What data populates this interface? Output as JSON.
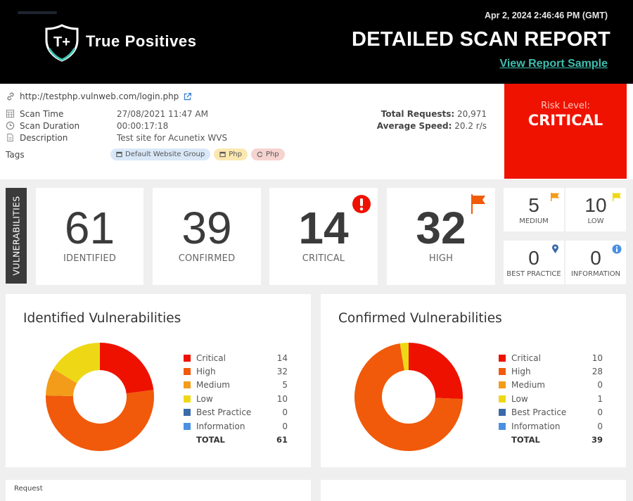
{
  "header": {
    "brand": "True Positives",
    "datetime": "Apr 2, 2024  2:46:46 PM (GMT)",
    "title": "DETAILED SCAN REPORT",
    "link": "View Report Sample"
  },
  "info": {
    "url": "http://testphp.vulnweb.com/login.php",
    "rows": [
      {
        "icon": "calendar-icon",
        "label": "Scan Time",
        "value": "27/08/2021 11:47 AM"
      },
      {
        "icon": "clock-icon",
        "label": "Scan Duration",
        "value": "00:00:17:18"
      },
      {
        "icon": "document-icon",
        "label": "Description",
        "value": "Test site for Acunetix WVS"
      }
    ],
    "tags_label": "Tags",
    "tags": [
      {
        "label": "Default Website Group",
        "color": "#d9e8f8"
      },
      {
        "label": "Php",
        "color": "#fbe8b0"
      },
      {
        "label": "Php",
        "color": "#f6d3cf"
      }
    ],
    "total_requests_label": "Total Requests:",
    "total_requests": "20,971",
    "avg_speed_label": "Average Speed:",
    "avg_speed": "20.2 r/s",
    "risk_label": "Risk Level:",
    "risk_value": "CRITICAL"
  },
  "vulnerabilities": {
    "side_label": "VULNERABILITIES",
    "identified": {
      "value": "61",
      "label": "IDENTIFIED"
    },
    "confirmed": {
      "value": "39",
      "label": "CONFIRMED"
    },
    "critical": {
      "value": "14",
      "label": "CRITICAL"
    },
    "high": {
      "value": "32",
      "label": "HIGH"
    },
    "medium": {
      "value": "5",
      "label": "MEDIUM"
    },
    "low": {
      "value": "10",
      "label": "LOW"
    },
    "best_practice": {
      "value": "0",
      "label": "BEST PRACTICE"
    },
    "information": {
      "value": "0",
      "label": "INFORMATION"
    }
  },
  "colors": {
    "critical": "#ee1100",
    "high": "#f05a0a",
    "medium": "#f39c1a",
    "low": "#eed816",
    "best_practice": "#3a6aa8",
    "information": "#4a90e2",
    "accent": "#3fbfb0"
  },
  "chart_data": [
    {
      "type": "pie",
      "title": "Identified Vulnerabilities",
      "categories": [
        "Critical",
        "High",
        "Medium",
        "Low",
        "Best Practice",
        "Information"
      ],
      "values": [
        14,
        32,
        5,
        10,
        0,
        0
      ],
      "total_label": "TOTAL",
      "total": 61,
      "legend": "right"
    },
    {
      "type": "pie",
      "title": "Confirmed Vulnerabilities",
      "categories": [
        "Critical",
        "High",
        "Medium",
        "Low",
        "Best Practice",
        "Information"
      ],
      "values": [
        10,
        28,
        0,
        1,
        0,
        0
      ],
      "total_label": "TOTAL",
      "total": 39,
      "legend": "right"
    }
  ],
  "bottom": {
    "left_title": "Request"
  }
}
